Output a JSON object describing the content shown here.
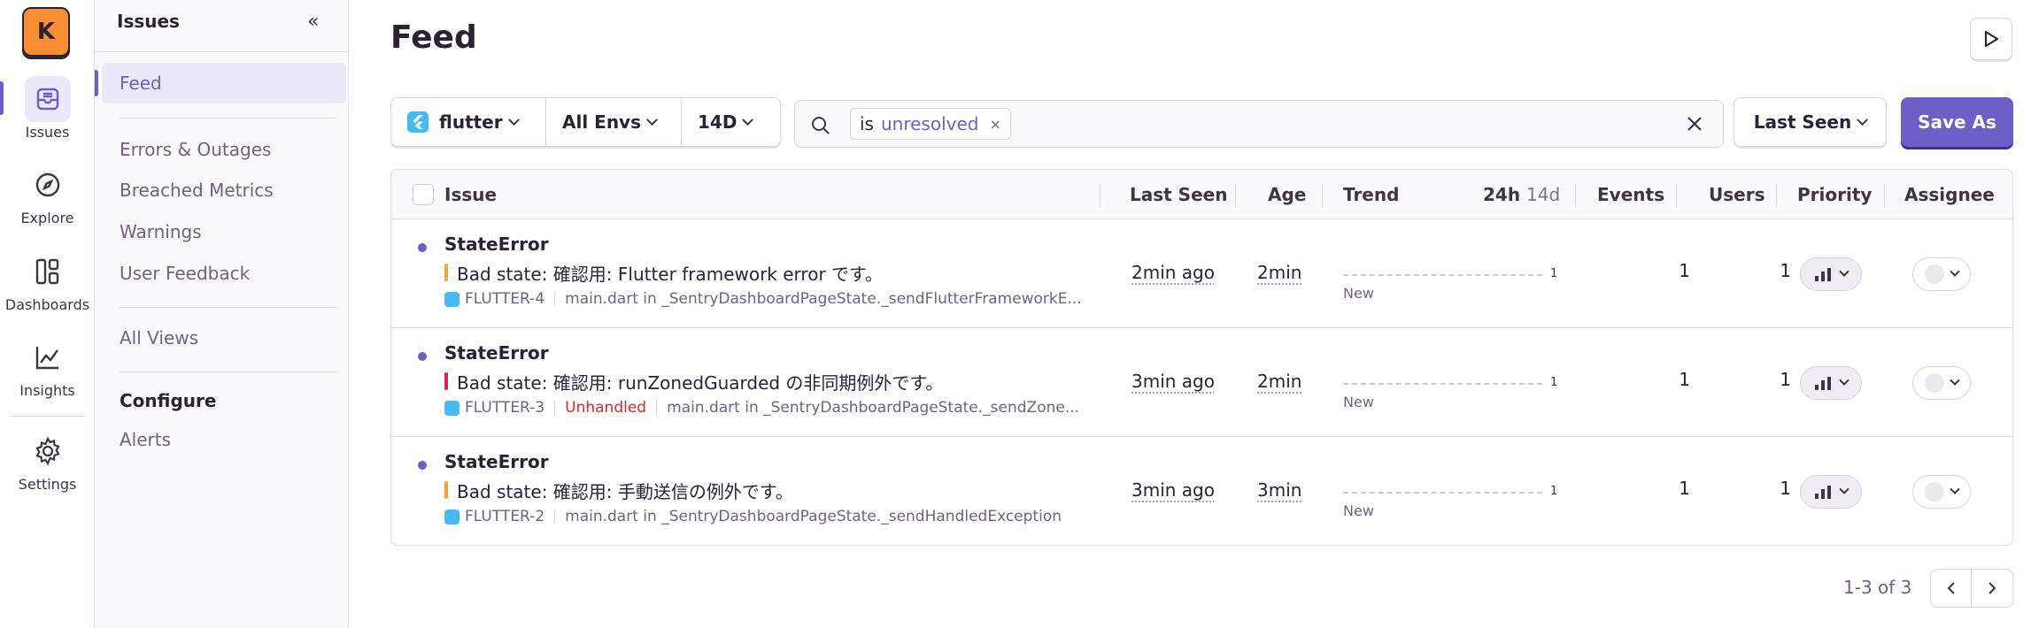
{
  "org": {
    "initial": "K"
  },
  "rail": [
    {
      "label": "Issues",
      "icon": "inbox-icon",
      "active": true
    },
    {
      "label": "Explore",
      "icon": "compass-icon"
    },
    {
      "label": "Dashboards",
      "icon": "dashboard-icon"
    },
    {
      "label": "Insights",
      "icon": "graph-icon"
    },
    {
      "label": "Settings",
      "icon": "gear-icon"
    }
  ],
  "subnav": {
    "title": "Issues",
    "collapse_icon": "«",
    "items": [
      "Feed",
      "Errors & Outages",
      "Breached Metrics",
      "Warnings",
      "User Feedback",
      "All Views"
    ],
    "configure_heading": "Configure",
    "configure_items": [
      "Alerts"
    ]
  },
  "page": {
    "title": "Feed"
  },
  "filters": {
    "project": "flutter",
    "env": "All Envs",
    "period": "14D"
  },
  "search": {
    "token_key": "is",
    "token_value": "unresolved",
    "token_remove": "×",
    "placeholder": ""
  },
  "sort": {
    "label": "Last Seen"
  },
  "save_as": {
    "label": "Save As"
  },
  "table": {
    "headers": {
      "issue": "Issue",
      "last_seen": "Last Seen",
      "age": "Age",
      "trend": "Trend",
      "trend_24h": "24h",
      "trend_14d": "14d",
      "events": "Events",
      "users": "Users",
      "priority": "Priority",
      "assignee": "Assignee"
    },
    "rows": [
      {
        "title": "StateError",
        "message": "Bad state: 確認用: Flutter framework error です。",
        "level_color": "#f5a23e",
        "short_id": "FLUTTER-4",
        "unhandled": "",
        "culprit": "main.dart in _SentryDashboardPageState._sendFlutterFrameworkE...",
        "last_seen": "2min ago",
        "age": "2min",
        "trend_value": "1",
        "trend_label": "New",
        "events": "1",
        "users": "1"
      },
      {
        "title": "StateError",
        "message": "Bad state: 確認用: runZonedGuarded の非同期例外です。",
        "level_color": "#e0214d",
        "short_id": "FLUTTER-3",
        "unhandled": "Unhandled",
        "culprit": "main.dart in _SentryDashboardPageState._sendZone...",
        "last_seen": "3min ago",
        "age": "2min",
        "trend_value": "1",
        "trend_label": "New",
        "events": "1",
        "users": "1"
      },
      {
        "title": "StateError",
        "message": "Bad state: 確認用: 手動送信の例外です。",
        "level_color": "#f5a23e",
        "short_id": "FLUTTER-2",
        "unhandled": "",
        "culprit": "main.dart in _SentryDashboardPageState._sendHandledException",
        "last_seen": "3min ago",
        "age": "3min",
        "trend_value": "1",
        "trend_label": "New",
        "events": "1",
        "users": "1"
      }
    ]
  },
  "pagination": {
    "text": "1-3 of 3"
  },
  "colors": {
    "accent": "#6c5fc7",
    "unhandled": "#d12c2c"
  }
}
